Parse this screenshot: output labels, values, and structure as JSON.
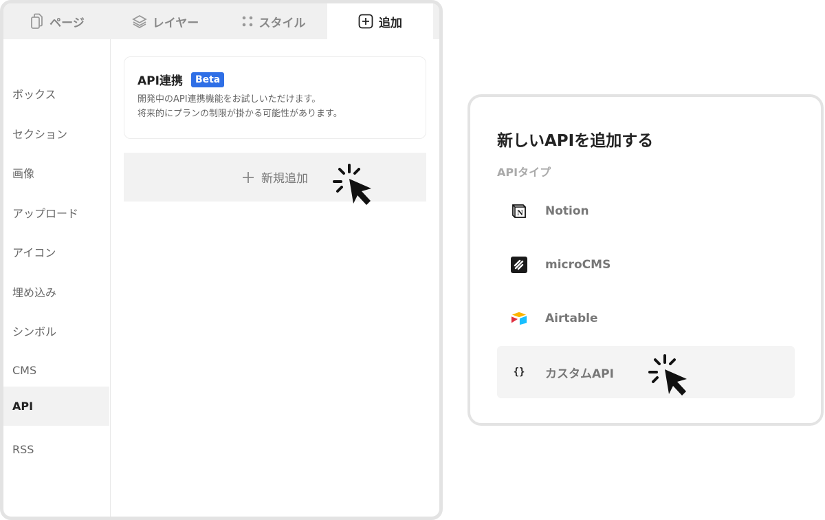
{
  "tabs": [
    {
      "label": "ページ",
      "icon": "page-icon"
    },
    {
      "label": "レイヤー",
      "icon": "layers-icon"
    },
    {
      "label": "スタイル",
      "icon": "style-icon"
    },
    {
      "label": "追加",
      "icon": "plus-square-icon",
      "active": true
    }
  ],
  "sidebar": {
    "items": [
      {
        "label": "ボックス"
      },
      {
        "label": "セクション"
      },
      {
        "label": "画像"
      },
      {
        "label": "アップロード"
      },
      {
        "label": "アイコン"
      },
      {
        "label": "埋め込み"
      },
      {
        "label": "シンボル"
      },
      {
        "label": "CMS"
      },
      {
        "label": "API",
        "active": true
      },
      {
        "label": "RSS"
      }
    ]
  },
  "card": {
    "title": "API連携",
    "badge": "Beta",
    "desc1": "開発中のAPI連携機能をお試しいただけます。",
    "desc2": "将来的にプランの制限が掛かる可能性があります。"
  },
  "add_button": {
    "label": "新規追加",
    "icon": "plus-icon"
  },
  "dialog": {
    "title": "新しいAPIを追加する",
    "label": "APIタイプ",
    "items": [
      {
        "label": "Notion",
        "icon": "notion-icon"
      },
      {
        "label": "microCMS",
        "icon": "microcms-icon"
      },
      {
        "label": "Airtable",
        "icon": "airtable-icon"
      },
      {
        "label": "カスタムAPI",
        "icon": "braces-icon",
        "selected": true
      }
    ]
  },
  "colors": {
    "accent": "#2f6fe6",
    "border": "#e3e3e3",
    "selected_bg": "#f2f2f2"
  }
}
